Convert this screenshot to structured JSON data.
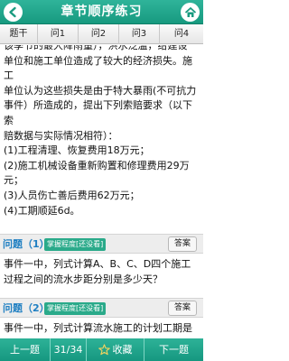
{
  "header": {
    "title": "章节顺序练习",
    "back_icon": "back-arrow-icon",
    "home_icon": "home-icon"
  },
  "tabs": [
    {
      "label": "题干"
    },
    {
      "label": "问1"
    },
    {
      "label": "问2"
    },
    {
      "label": "问3"
    },
    {
      "label": "问4"
    }
  ],
  "case": {
    "lines": [
      "该季节的最大降雨量），洪水泛滥，给建设",
      "单位和施工单位造成了较大的经济损失。施",
      "工",
      "单位认为这些损失是由于特大暴雨(不可抗力",
      "事件）所造成的，提出下列索赔要求（以下",
      "索",
      "赔数据与实际情况相符）：",
      "(1)工程清理、恢复费用18万元；",
      "(2)施工机械设备重新购置和修理费用29万",
      "元；",
      "(3)人员伤亡善后费用62万元；",
      "(4)工期顺延6d。"
    ]
  },
  "questions": [
    {
      "label": "问题（1）",
      "mastery": "掌握程度[还没看]",
      "answer_button": "答案",
      "text": "事件一中，列式计算A、B、C、D四个施工过程之间的流水步距分别是多少天？"
    },
    {
      "label": "问题（2）",
      "mastery": "掌握程度[还没看]",
      "answer_button": "答案",
      "text": "事件一中，列式计算流水施工的计划工期是"
    }
  ],
  "bottom": {
    "prev": "上一题",
    "page": "31/34",
    "favorite": "收藏",
    "next": "下一题",
    "star_icon": "star-outline-icon"
  },
  "colors": {
    "accent": "#1fa68b",
    "question_blue": "#1f7fc2",
    "mastery_badge": "#2aaa8a"
  }
}
